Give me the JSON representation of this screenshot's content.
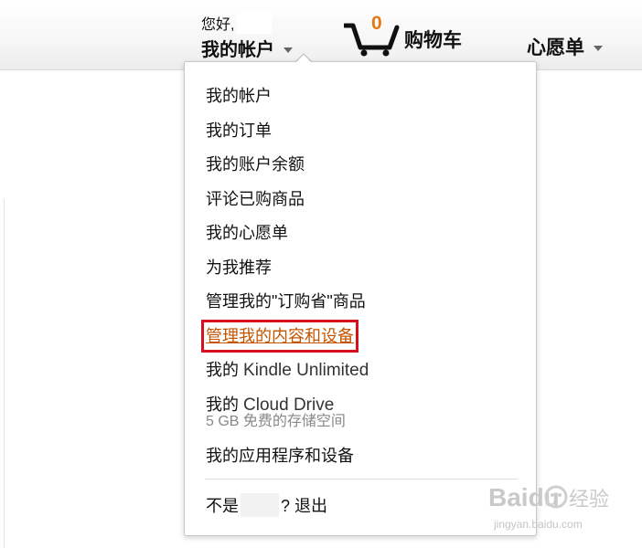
{
  "header": {
    "greeting": "您好,",
    "account_link": "我的帐户",
    "cart": {
      "count": "0",
      "label": "购物车"
    },
    "wishlist": "心愿单"
  },
  "account_menu": {
    "items": [
      {
        "label": "我的帐户"
      },
      {
        "label": "我的订单"
      },
      {
        "label": "我的账户余额"
      },
      {
        "label": "评论已购商品"
      },
      {
        "label": "我的心愿单"
      },
      {
        "label": "为我推荐"
      },
      {
        "label": "管理我的\"订购省\"商品"
      },
      {
        "label": "管理我的内容和设备"
      },
      {
        "prefix": "我的",
        "latin": "Kindle Unlimited"
      },
      {
        "prefix": "我的",
        "latin": "Cloud Drive",
        "sub": "5 GB 免费的存储空间"
      },
      {
        "label": "我的应用程序和设备"
      }
    ],
    "signout_prefix": "不是",
    "signout_suffix": "? 退出"
  },
  "watermark": {
    "brand": "Baidu",
    "text": "经验",
    "url": "jingyan.baidu.com"
  },
  "colors": {
    "accent": "#e47911",
    "highlight_border": "#d8101e",
    "link_active": "#c45500"
  }
}
